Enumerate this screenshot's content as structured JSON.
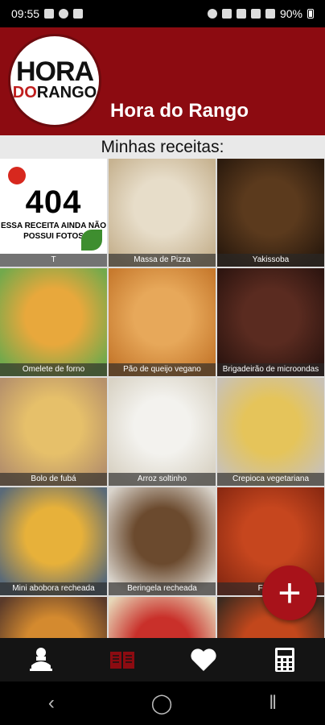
{
  "status": {
    "time": "09:55",
    "battery": "90%"
  },
  "logo": {
    "line1": "HORA",
    "line2a": "DO",
    "line2b": "RANGO"
  },
  "header": {
    "title": "Hora do Rango"
  },
  "section": {
    "title": "Minhas receitas:"
  },
  "placeholder": {
    "code": "404",
    "message": "ESSA RECEITA AINDA NÃO POSSUI FOTOS"
  },
  "recipes": [
    {
      "name": "T",
      "palette": [
        "#ffffff",
        "#ffffff"
      ]
    },
    {
      "name": "Massa de Pizza",
      "palette": [
        "#e7ddc9",
        "#c7b391"
      ]
    },
    {
      "name": "Yakissoba",
      "palette": [
        "#5b3a1d",
        "#2c1b0e"
      ]
    },
    {
      "name": "Omelete de forno",
      "palette": [
        "#e8a83c",
        "#72a94c"
      ]
    },
    {
      "name": "Pão de queijo vegano",
      "palette": [
        "#e7a85a",
        "#c77a2e"
      ]
    },
    {
      "name": "Brigadeirão de microondas",
      "palette": [
        "#5a2b20",
        "#2e1510"
      ]
    },
    {
      "name": "Bolo de fubá",
      "palette": [
        "#e6c06a",
        "#b6916b"
      ]
    },
    {
      "name": "Arroz soltinho",
      "palette": [
        "#f3f2ee",
        "#d9d3c5"
      ]
    },
    {
      "name": "Crepioca vegetariana",
      "palette": [
        "#e5c45a",
        "#c9c1b4"
      ]
    },
    {
      "name": "Mini abobora recheada",
      "palette": [
        "#e7b13a",
        "#5a6a78"
      ]
    },
    {
      "name": "Beringela recheada",
      "palette": [
        "#6b4a2e",
        "#d9d4cc"
      ]
    },
    {
      "name": "Frango",
      "palette": [
        "#c6461e",
        "#8c2a12"
      ]
    },
    {
      "name": "",
      "palette": [
        "#d48a2f",
        "#5a3a2a"
      ]
    },
    {
      "name": "",
      "palette": [
        "#c9302a",
        "#e7d7b8"
      ]
    },
    {
      "name": "",
      "palette": [
        "#c2471c",
        "#3c2a1f"
      ]
    }
  ],
  "nav": {
    "items": [
      "chef-icon",
      "recipe-book-icon",
      "heart-icon",
      "calculator-icon"
    ],
    "active_color": "#8c0b11"
  },
  "fab": {
    "label": "+"
  },
  "colors": {
    "brand": "#8c0b11",
    "fab": "#a8121a"
  }
}
